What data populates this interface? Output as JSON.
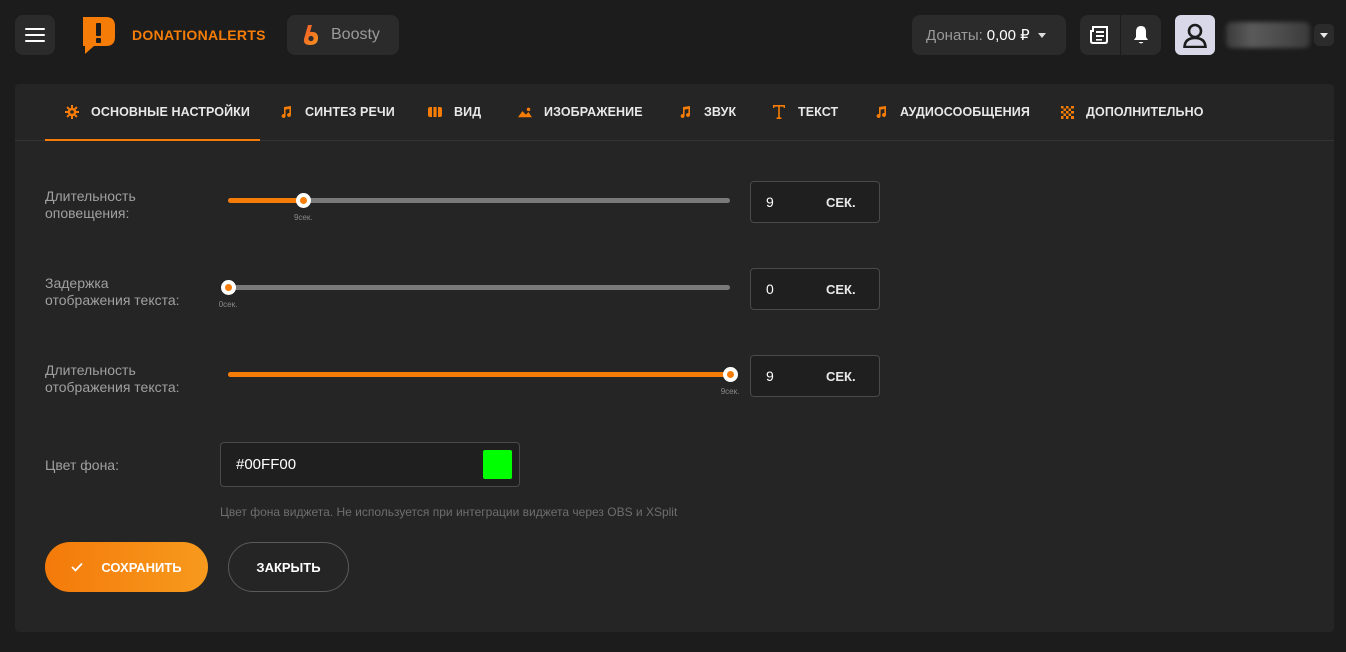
{
  "colors": {
    "accent": "#f57d07",
    "background_swatch": "#00FF00"
  },
  "header": {
    "brand": "DONATIONALERTS",
    "boosty_label": "Boosty",
    "donations_label": "Донаты:",
    "donations_value": "0,00 ₽",
    "icons": [
      "menu-icon",
      "donationalerts-logo",
      "boosty-logo",
      "newspaper-icon",
      "bell-icon",
      "user-icon",
      "chevron-down-icon"
    ]
  },
  "tabs": [
    {
      "label": "ОСНОВНЫЕ НАСТРОЙКИ",
      "icon": "gear-icon",
      "active": true
    },
    {
      "label": "СИНТЕЗ РЕЧИ",
      "icon": "music-note-icon"
    },
    {
      "label": "ВИД",
      "icon": "film-icon"
    },
    {
      "label": "ИЗОБРАЖЕНИЕ",
      "icon": "image-icon"
    },
    {
      "label": "ЗВУК",
      "icon": "music-note-icon"
    },
    {
      "label": "ТЕКСТ",
      "icon": "text-icon"
    },
    {
      "label": "АУДИОСООБЩЕНИЯ",
      "icon": "music-note-icon"
    },
    {
      "label": "ДОПОЛНИТЕЛЬНО",
      "icon": "grid-icon"
    }
  ],
  "settings": {
    "alert_duration": {
      "label_1": "Длительность",
      "label_2": "оповещения:",
      "value": "9",
      "unit": "СЕК.",
      "mark": "9сек.",
      "fraction": 0.15
    },
    "text_delay": {
      "label_1": "Задержка",
      "label_2": "отображения текста:",
      "value": "0",
      "unit": "СЕК.",
      "mark": "0сек.",
      "fraction": 0.0
    },
    "text_duration": {
      "label_1": "Длительность",
      "label_2": "отображения текста:",
      "value": "9",
      "unit": "СЕК.",
      "mark": "9сек.",
      "fraction": 1.0
    },
    "background_color": {
      "label": "Цвет фона:",
      "value": "#00FF00",
      "hint": "Цвет фона виджета. Не используется при интеграции виджета через OBS и XSplit"
    }
  },
  "buttons": {
    "save": "СОХРАНИТЬ",
    "close": "ЗАКРЫТЬ"
  }
}
